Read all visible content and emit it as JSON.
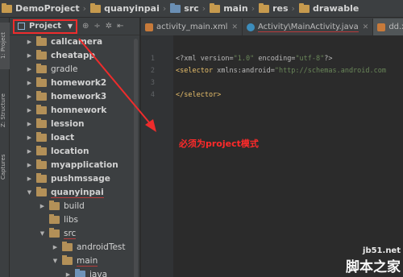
{
  "breadcrumb": [
    {
      "label": "DemoProject",
      "icon": "folder-icon"
    },
    {
      "label": "quanyinpai",
      "icon": "folder-icon"
    },
    {
      "label": "src",
      "icon": "folder-icon"
    },
    {
      "label": "main",
      "icon": "folder-icon"
    },
    {
      "label": "res",
      "icon": "folder-icon"
    },
    {
      "label": "drawable",
      "icon": "folder-icon"
    }
  ],
  "left_strip": {
    "project_tab": "1: Project",
    "structure_tab": "Z: Structure",
    "captures_tab": "Captures"
  },
  "panel": {
    "view_selector": "Project",
    "toolbar_icons": [
      "target-icon",
      "split-icon",
      "gear-icon",
      "collapse-icon"
    ]
  },
  "tree": [
    {
      "label": "callcamera",
      "expanded": false
    },
    {
      "label": "cheatapp",
      "expanded": false
    },
    {
      "label": "gradle",
      "expanded": false
    },
    {
      "label": "homework2",
      "expanded": false
    },
    {
      "label": "homework3",
      "expanded": false
    },
    {
      "label": "homnework",
      "expanded": false
    },
    {
      "label": "lession",
      "expanded": false
    },
    {
      "label": "loact",
      "expanded": false
    },
    {
      "label": "location",
      "expanded": false
    },
    {
      "label": "myapplication",
      "expanded": false
    },
    {
      "label": "pushmssage",
      "expanded": false
    },
    {
      "label": "quanyinpai",
      "expanded": true
    },
    {
      "label": "build",
      "expanded": false
    },
    {
      "label": "libs",
      "expanded": false
    },
    {
      "label": "src",
      "expanded": true
    },
    {
      "label": "androidTest",
      "expanded": false
    },
    {
      "label": "main",
      "expanded": true
    },
    {
      "label": "java",
      "expanded": false
    }
  ],
  "tabs": [
    {
      "label": "activity_main.xml",
      "active": false
    },
    {
      "label": "Activity\\MainActivity.java",
      "active": false
    },
    {
      "label": "dd.xml",
      "active": true
    }
  ],
  "editor": {
    "lines": [
      "1",
      "2",
      "3",
      "4"
    ],
    "code": [
      {
        "a": "<?xml version=",
        "b": "\"1.0\"",
        "c": " encoding=",
        "d": "\"utf-8\"",
        "e": "?>"
      },
      {
        "a": "<selector",
        "b": " xmlns:android=",
        "c": "\"http://schemas.android.com",
        "d": "",
        "e": ""
      },
      {
        "a": "",
        "b": "",
        "c": "",
        "d": "",
        "e": ""
      },
      {
        "a": "</selector>",
        "b": "",
        "c": "",
        "d": "",
        "e": ""
      }
    ]
  },
  "annotation": "必须为project模式",
  "watermark": {
    "url": "jb51.net",
    "logo": "脚本之家"
  },
  "colors": {
    "annotation_red": "#ee2c2c",
    "tag_yellow": "#e8bf6a",
    "string_green": "#6a8759"
  }
}
